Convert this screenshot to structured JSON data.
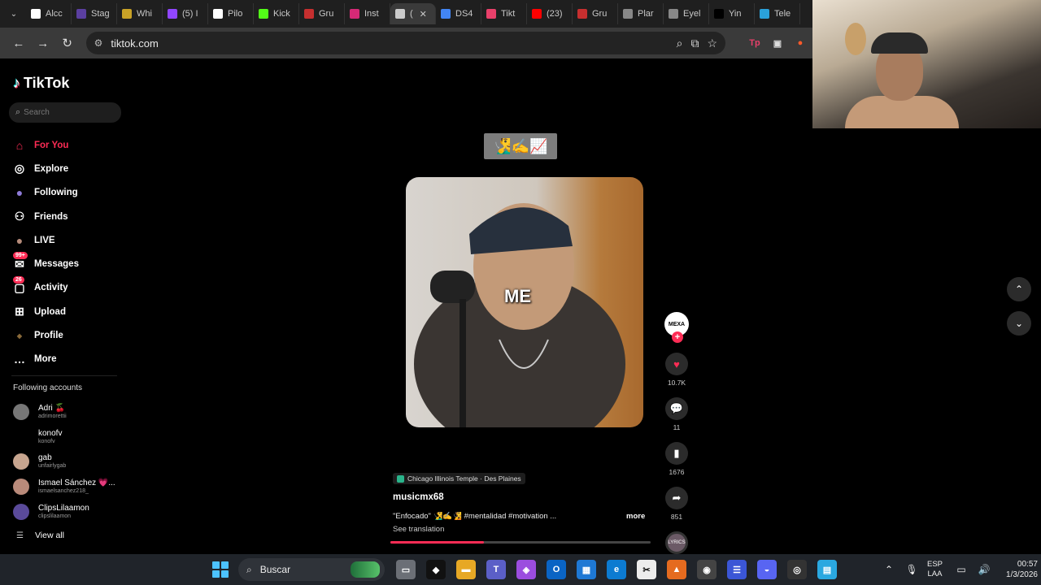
{
  "browser": {
    "tabs": [
      {
        "label": "Alcc",
        "icon": "notion-icon",
        "color": "#ffffff"
      },
      {
        "label": "Stag",
        "icon": "stag-icon",
        "color": "#5b3fa0"
      },
      {
        "label": "Whi",
        "icon": "whi-icon",
        "color": "#c9a227"
      },
      {
        "label": "(5) I",
        "icon": "twitch-icon",
        "color": "#9146ff"
      },
      {
        "label": "Pilo",
        "icon": "pilot-icon",
        "color": "#ffffff"
      },
      {
        "label": "Kick",
        "icon": "kick-icon",
        "color": "#53fc18"
      },
      {
        "label": "Gru",
        "icon": "gru-icon",
        "color": "#c62f2f"
      },
      {
        "label": "Inst",
        "icon": "instagram-icon",
        "color": "#d62976"
      },
      {
        "label": "(",
        "icon": "audio-icon",
        "color": "#cccccc",
        "active": true
      },
      {
        "label": "DS4",
        "icon": "docs-icon",
        "color": "#4285f4"
      },
      {
        "label": "Tikt",
        "icon": "tiktok-tab-icon",
        "color": "#e8406a"
      },
      {
        "label": "(23)",
        "icon": "youtube-icon",
        "color": "#ff0000"
      },
      {
        "label": "Gru",
        "icon": "gru-icon",
        "color": "#c62f2f"
      },
      {
        "label": "Plar",
        "icon": "globe-icon",
        "color": "#888888"
      },
      {
        "label": "Eyel",
        "icon": "globe-icon",
        "color": "#888888"
      },
      {
        "label": "Yin",
        "icon": "y-icon",
        "color": "#000000"
      },
      {
        "label": "Tele",
        "icon": "telegram-icon",
        "color": "#2aa1da"
      }
    ],
    "url": "tiktok.com"
  },
  "sidebar": {
    "brand": "TikTok",
    "search_placeholder": "Search",
    "nav": [
      {
        "label": "For You",
        "icon": "home-icon",
        "active": true
      },
      {
        "label": "Explore",
        "icon": "compass-icon"
      },
      {
        "label": "Following",
        "icon": "following-avatar-icon"
      },
      {
        "label": "Friends",
        "icon": "friends-icon"
      },
      {
        "label": "LIVE",
        "icon": "live-avatar-icon"
      },
      {
        "label": "Messages",
        "icon": "messages-icon",
        "badge": "99+"
      },
      {
        "label": "Activity",
        "icon": "activity-icon",
        "badge": "26"
      },
      {
        "label": "Upload",
        "icon": "upload-icon"
      },
      {
        "label": "Profile",
        "icon": "profile-icon"
      },
      {
        "label": "More",
        "icon": "more-icon"
      }
    ],
    "following_title": "Following accounts",
    "accounts": [
      {
        "name": "Adri 🍒",
        "user": "adrimorettii",
        "color": "#777777"
      },
      {
        "name": "konofv",
        "user": "konofv",
        "color": "#000000"
      },
      {
        "name": "gab",
        "user": "unfairlygab",
        "color": "#c7a58f"
      },
      {
        "name": "Ismael Sánchez 💗...",
        "user": "ismaelsanchez218_",
        "color": "#b98a7a"
      },
      {
        "name": "ClipsLilaamon",
        "user": "clipslilaamon",
        "color": "#5a4a9a"
      }
    ],
    "view_all": "View all"
  },
  "video": {
    "sticker": "🧏‍♂️✍️📈",
    "overlay_text": "ME",
    "location": "Chicago Illinois Temple · Des Plaines",
    "author": "musicmx68",
    "description": "\"Enfocado\" 🧏‍♂️✍️🧏 #mentalidad #motivation ...",
    "more": "more",
    "see_translation": "See translation",
    "progress": 0.36
  },
  "actions": {
    "author_avatar": "MEXA",
    "likes": "10.7K",
    "comments": "11",
    "saves": "1676",
    "shares": "851",
    "sound": "LYRICS"
  },
  "taskbar": {
    "search": "Buscar",
    "lang_top": "ESP",
    "lang_bottom": "LAA",
    "time": "00:57",
    "date": "1/3/2026"
  }
}
